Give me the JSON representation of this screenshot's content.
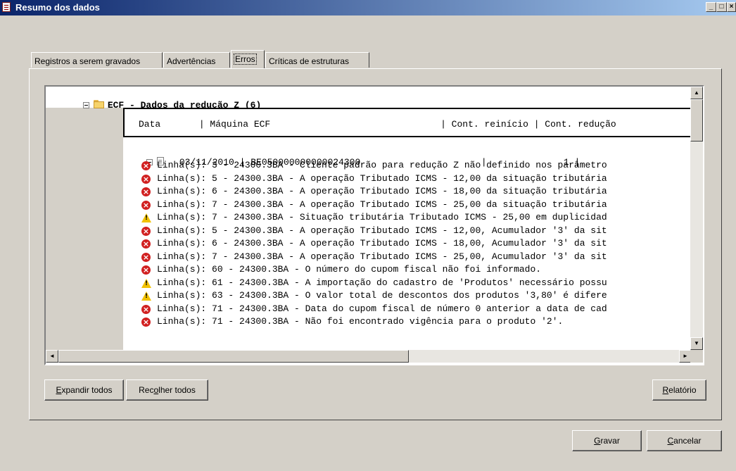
{
  "window": {
    "title": "Resumo dos dados",
    "minimize_glyph": "_",
    "maximize_glyph": "□",
    "close_glyph": "×"
  },
  "tabs": [
    {
      "label": "Registros a serem gravados",
      "active": false
    },
    {
      "label": "Advertências",
      "active": false
    },
    {
      "label": "Erros",
      "active": true
    },
    {
      "label": "Críticas de estruturas",
      "active": false
    }
  ],
  "tree": {
    "root_label": "ECF - Dados da redução Z (6)",
    "header_line": "Data       | Máquina ECF                               | Cont. reinício | Cont. redução",
    "record_line": "03/11/2010 | BE050000000000024300                      |              1 |",
    "messages": [
      {
        "type": "error",
        "icon": "error-icon",
        "text": "Linha(s): 3 - 24300.3BA - Cliente padrão para redução Z não definido nos parâmetro"
      },
      {
        "type": "error",
        "icon": "error-icon",
        "text": "Linha(s): 5 - 24300.3BA - A operação Tributado ICMS - 12,00 da situação tributária"
      },
      {
        "type": "error",
        "icon": "error-icon",
        "text": "Linha(s): 6 - 24300.3BA - A operação Tributado ICMS - 18,00 da situação tributária"
      },
      {
        "type": "error",
        "icon": "error-icon",
        "text": "Linha(s): 7 - 24300.3BA - A operação Tributado ICMS - 25,00 da situação tributária"
      },
      {
        "type": "warning",
        "icon": "warning-icon",
        "text": "Linha(s): 7 - 24300.3BA - Situação tributária Tributado ICMS - 25,00 em duplicidad"
      },
      {
        "type": "error",
        "icon": "error-icon",
        "text": "Linha(s): 5 - 24300.3BA - A operação Tributado ICMS - 12,00, Acumulador '3' da sit"
      },
      {
        "type": "error",
        "icon": "error-icon",
        "text": "Linha(s): 6 - 24300.3BA - A operação Tributado ICMS - 18,00, Acumulador '3' da sit"
      },
      {
        "type": "error",
        "icon": "error-icon",
        "text": "Linha(s): 7 - 24300.3BA - A operação Tributado ICMS - 25,00, Acumulador '3' da sit"
      },
      {
        "type": "error",
        "icon": "error-icon",
        "text": "Linha(s): 60 - 24300.3BA - O número do cupom fiscal não foi informado."
      },
      {
        "type": "warning",
        "icon": "warning-icon",
        "text": "Linha(s): 61 - 24300.3BA - A importação do cadastro de 'Produtos' necessário possu"
      },
      {
        "type": "warning",
        "icon": "warning-icon",
        "text": "Linha(s): 63 - 24300.3BA - O valor total de descontos dos produtos '3,80' é difere"
      },
      {
        "type": "error",
        "icon": "error-icon",
        "text": "Linha(s): 71 - 24300.3BA - Data do cupom fiscal de número 0 anterior a data de cad"
      },
      {
        "type": "error",
        "icon": "error-icon",
        "text": "Linha(s): 71 - 24300.3BA - Não foi encontrado vigência para o produto '2'."
      }
    ]
  },
  "buttons": {
    "expand_all_prefix": "",
    "expand_all_key": "E",
    "expand_all_rest": "xpandir todos",
    "collapse_all_prefix": "Rec",
    "collapse_all_key": "o",
    "collapse_all_rest": "lher todos",
    "report_key": "R",
    "report_rest": "elatório",
    "save_key": "G",
    "save_rest": "ravar",
    "cancel_key": "C",
    "cancel_rest": "ancelar"
  },
  "colors": {
    "title_bar_start": "#0a246a",
    "title_bar_end": "#a6caf0",
    "error": "#d12020",
    "warning": "#f2c200",
    "face": "#d4d0c8"
  }
}
